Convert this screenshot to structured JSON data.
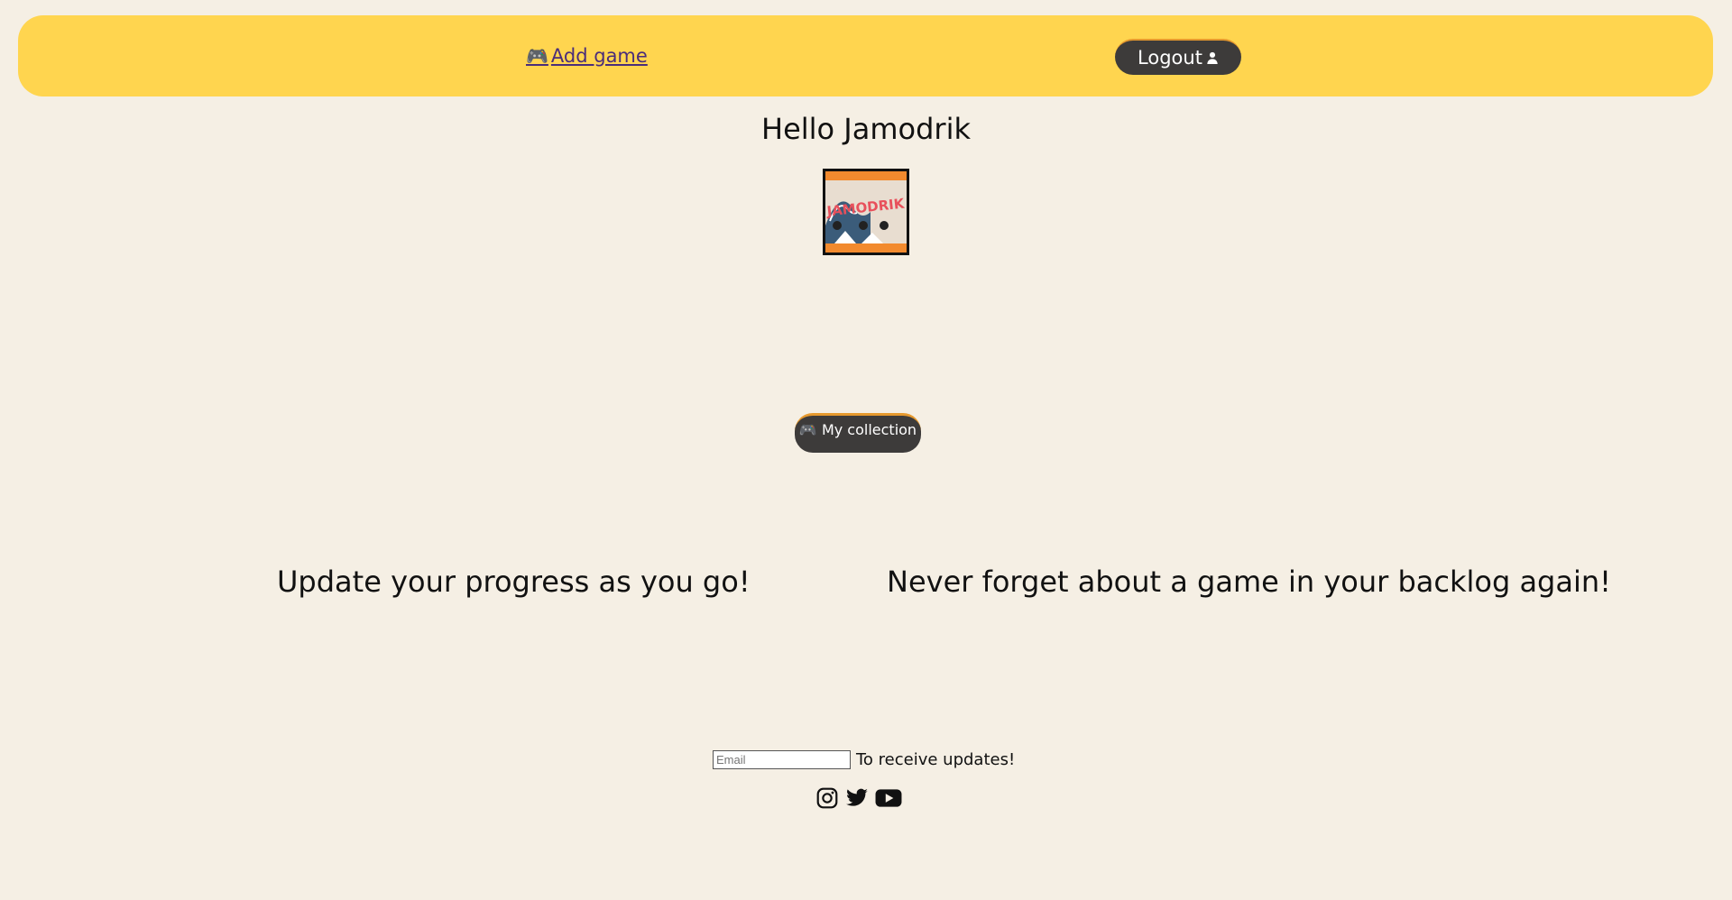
{
  "nav": {
    "add_game_icon": "gamepad-icon",
    "add_game_label": "Add game",
    "logout_label": "Logout",
    "logout_icon": "user-icon"
  },
  "colors": {
    "background": "#f5efe4",
    "navbar": "#ffd54f",
    "button": "#3d3b3a",
    "button_accent": "#e6992e"
  },
  "greeting": "Hello Jamodrik",
  "avatar": {
    "logo_text": "JAMODRIK"
  },
  "collection_button": {
    "icon": "gamepad-icon",
    "label": "My collection"
  },
  "features": [
    "Update your progress as you go!",
    "Never forget about a game in your backlog again!"
  ],
  "newsletter": {
    "placeholder": "Email",
    "label": "To receive updates!"
  },
  "socials": [
    "instagram-icon",
    "twitter-icon",
    "youtube-icon"
  ]
}
